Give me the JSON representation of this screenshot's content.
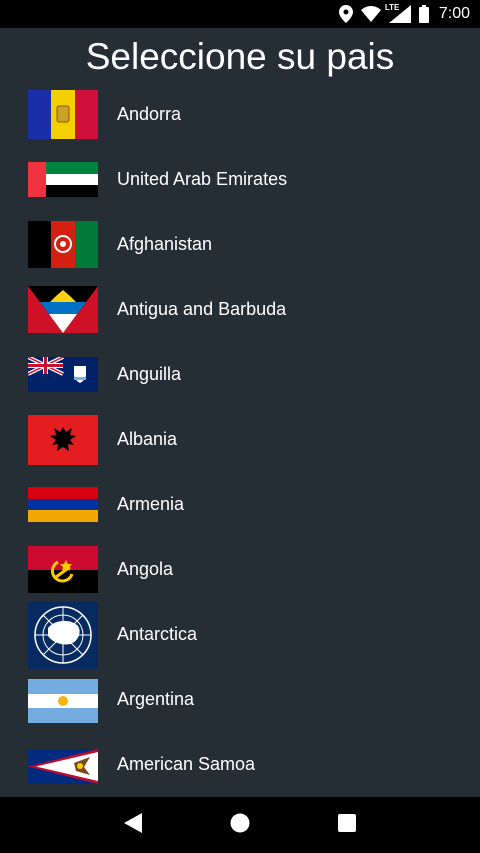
{
  "status_bar": {
    "time": "7:00",
    "network_label": "LTE",
    "icons": [
      "location-icon",
      "wifi-icon",
      "lte-signal-icon",
      "battery-icon"
    ]
  },
  "title": "Seleccione su pais",
  "countries": [
    {
      "name": "Andorra",
      "flag": "andorra-flag-icon"
    },
    {
      "name": "United Arab Emirates",
      "flag": "uae-flag-icon"
    },
    {
      "name": "Afghanistan",
      "flag": "afghanistan-flag-icon"
    },
    {
      "name": "Antigua and Barbuda",
      "flag": "antigua-flag-icon"
    },
    {
      "name": "Anguilla",
      "flag": "anguilla-flag-icon"
    },
    {
      "name": "Albania",
      "flag": "albania-flag-icon"
    },
    {
      "name": "Armenia",
      "flag": "armenia-flag-icon"
    },
    {
      "name": "Angola",
      "flag": "angola-flag-icon"
    },
    {
      "name": "Antarctica",
      "flag": "antarctica-flag-icon"
    },
    {
      "name": "Argentina",
      "flag": "argentina-flag-icon"
    },
    {
      "name": "American Samoa",
      "flag": "american-samoa-flag-icon"
    }
  ],
  "nav_bar": {
    "icons": [
      "back-icon",
      "home-icon",
      "recents-icon"
    ]
  },
  "colors": {
    "background": "#262e35",
    "bars": "#000000",
    "text": "#ffffff"
  }
}
